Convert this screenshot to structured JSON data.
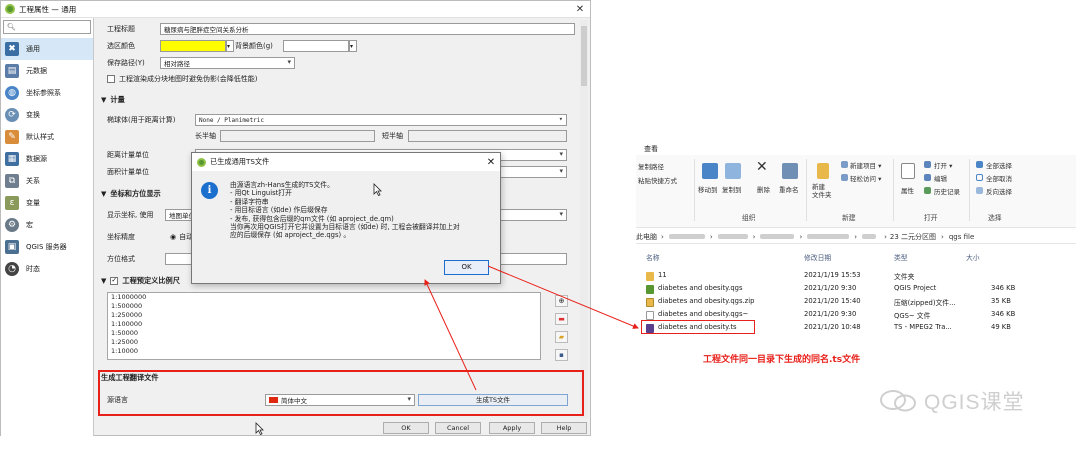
{
  "window": {
    "title": "工程属性 — 通用",
    "close": "✕"
  },
  "sidebar": {
    "search_placeholder": "",
    "items": [
      {
        "label": "通用",
        "icon": "tools-icon",
        "color": "#3a6ea5"
      },
      {
        "label": "元数据",
        "icon": "metadata-icon",
        "color": "#5b7ca6"
      },
      {
        "label": "坐标参照系",
        "icon": "globe-icon",
        "color": "#4a86c7"
      },
      {
        "label": "变换",
        "icon": "transform-icon",
        "color": "#6a8fb5"
      },
      {
        "label": "默认样式",
        "icon": "style-icon",
        "color": "#d98c3a"
      },
      {
        "label": "数据源",
        "icon": "datasource-icon",
        "color": "#3f6fa0"
      },
      {
        "label": "关系",
        "icon": "relations-icon",
        "color": "#6f7f8f"
      },
      {
        "label": "变量",
        "icon": "variables-icon",
        "color": "#8a9a5b"
      },
      {
        "label": "宏",
        "icon": "macro-icon",
        "color": "#6a7a88"
      },
      {
        "label": "QGIS 服务器",
        "icon": "server-icon",
        "color": "#4b6f91"
      },
      {
        "label": "时态",
        "icon": "clock-icon",
        "color": "#444444"
      }
    ]
  },
  "general": {
    "project_title_label": "工程标题",
    "project_title_value": "糖尿病与肥胖症空间关系分析",
    "selection_color_label": "选区颜色",
    "background_color_label": "背景颜色(g)",
    "save_paths_label": "保存路径(Y)",
    "save_paths_value": "相对路径",
    "avoid_artifacts_label": "工程渲染成分块地图时避免伪影(会降低性能)"
  },
  "measurements": {
    "section": "计量",
    "ellipsoid_label": "椭球体(用于距离计算)",
    "ellipsoid_value": "None / Planimetric",
    "semi_major_label": "长半轴",
    "semi_minor_label": "短半轴",
    "distance_units_label": "距离计量单位",
    "distance_units_value": "米",
    "area_units_label": "面积计量单位"
  },
  "coords": {
    "section": "坐标和方位显示",
    "display_label": "显示坐标, 使用",
    "display_value": "地图单位",
    "precision_label": "坐标精度",
    "precision_value": "自动",
    "bearing_label": "方位格式"
  },
  "scales": {
    "section": "工程预定义比例尺",
    "items": [
      "1:1000000",
      "1:500000",
      "1:250000",
      "1:100000",
      "1:50000",
      "1:25000",
      "1:10000"
    ]
  },
  "translation": {
    "section": "生成工程翻译文件",
    "source_lang_label": "源语言",
    "source_lang_value": "简体中文",
    "generate_button": "生成TS文件"
  },
  "buttons": {
    "ok": "OK",
    "cancel": "Cancel",
    "apply": "Apply",
    "help": "Help"
  },
  "dialog": {
    "title": "已生成通用TS文件",
    "lines": [
      "由源语言zh-Hans生成的TS文件。",
      "- 用Qt Linguist打开",
      "- 翻译字符串",
      "- 用目标语言 (如de) 作后缀保存",
      "- 发布, 获得包含后缀的qm文件 (如 aproject_de.qm)",
      "当你再次用QGIS打开它并设置为目标语言 (如de) 时, 工程会被翻译并加上对",
      "应的后缀保存 (如 aproject_de.qgs) 。"
    ],
    "ok": "OK"
  },
  "explorer": {
    "tab": "查看",
    "clipboard": {
      "copy_path": "复制路径",
      "paste_shortcut": "粘贴快捷方式"
    },
    "organize": {
      "label": "组织",
      "move_to": "移动到",
      "copy_to": "复制到",
      "delete": "删除",
      "rename": "重命名"
    },
    "new": {
      "label": "新建",
      "new_folder": "新建\n文件夹",
      "new_item": "新建项目 ▾",
      "easy_access": "轻松访问 ▾"
    },
    "open": {
      "label": "打开",
      "properties": "属性",
      "open": "打开 ▾",
      "edit": "编辑",
      "history": "历史记录"
    },
    "select": {
      "label": "选择",
      "select_all": "全部选择",
      "select_none": "全部取消",
      "invert": "反向选择"
    },
    "address": {
      "root": "此电脑",
      "folder1": "23 二元分区图",
      "folder2": "qgs file"
    },
    "columns": {
      "name": "名称",
      "date": "修改日期",
      "type": "类型",
      "size": "大小"
    },
    "files": [
      {
        "name": "11",
        "date": "2021/1/19 15:53",
        "type": "文件夹",
        "size": "",
        "color": "#e8b84a"
      },
      {
        "name": "diabetes and obesity.qgs",
        "date": "2021/1/20 9:30",
        "type": "QGIS Project",
        "size": "346 KB",
        "color": "#589632"
      },
      {
        "name": "diabetes and obesity.qgs.zip",
        "date": "2021/1/20 15:40",
        "type": "压缩(zipped)文件...",
        "size": "35 KB",
        "color": "#e8b84a"
      },
      {
        "name": "diabetes and obesity.qgs~",
        "date": "2021/1/20 9:30",
        "type": "QGS~ 文件",
        "size": "346 KB",
        "color": "#ffffff"
      },
      {
        "name": "diabetes and obesity.ts",
        "date": "2021/1/20 10:48",
        "type": "TS - MPEG2 Tra...",
        "size": "49 KB",
        "color": "#5a3f8c"
      }
    ]
  },
  "annotation": {
    "caption": "工程文件同一目录下生成的同名.ts文件",
    "accent": "#e8201a"
  },
  "watermark": {
    "text": "QGIS课堂"
  }
}
